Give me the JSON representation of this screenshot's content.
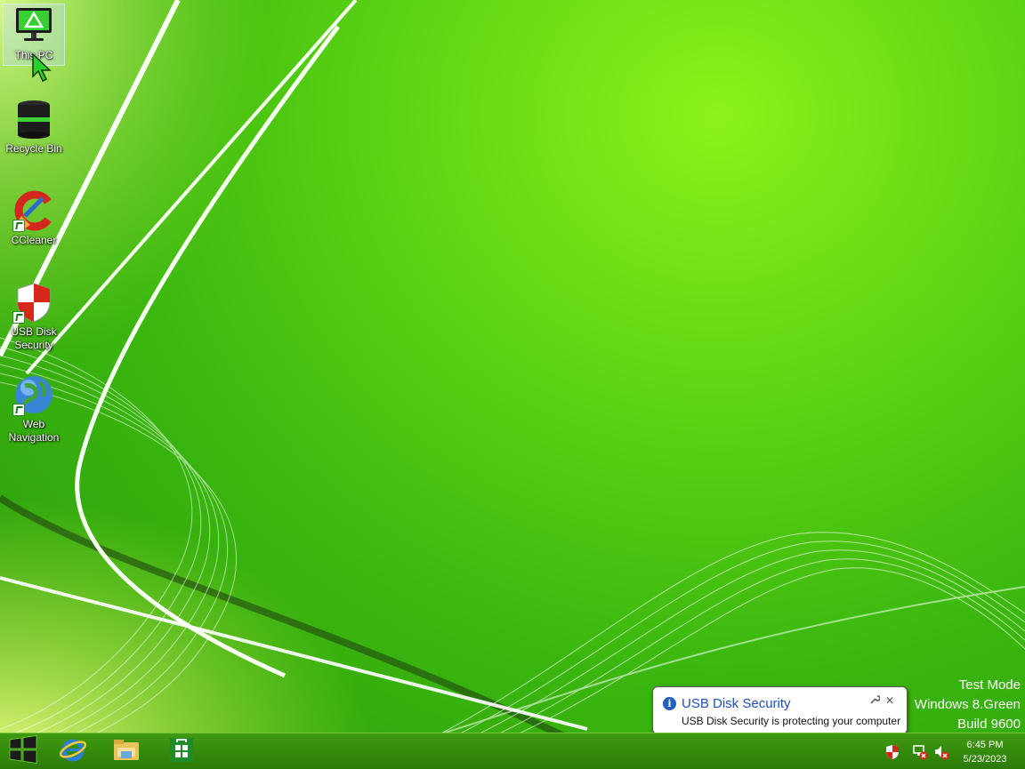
{
  "desktop": {
    "icons": [
      {
        "label": "This PC",
        "icon": "monitor-icon",
        "selected": true
      },
      {
        "label": "Recycle Bin",
        "icon": "recycle-bin-icon"
      },
      {
        "label": "CCleaner",
        "icon": "ccleaner-icon"
      },
      {
        "label": "USB Disk Security",
        "icon": "shield-icon"
      },
      {
        "label": "Web Navigation",
        "icon": "globe-icon"
      }
    ],
    "watermark": {
      "line1": "Test Mode",
      "line2": "Windows 8.Green",
      "line3": "Build 9600"
    }
  },
  "notification": {
    "title": "USB Disk Security",
    "message": "USB Disk Security is protecting your computer",
    "icon": "info-icon",
    "settings_icon": "wrench-icon",
    "close_icon": "close-icon"
  },
  "taskbar": {
    "buttons": [
      {
        "name": "start-button",
        "icon": "windows-logo-icon"
      },
      {
        "name": "internet-explorer-button",
        "icon": "internet-explorer-icon"
      },
      {
        "name": "file-explorer-button",
        "icon": "folder-icon"
      },
      {
        "name": "store-button",
        "icon": "store-icon"
      }
    ],
    "tray": {
      "icons": [
        "usb-disk-security-tray-icon",
        "network-disconnected-icon",
        "volume-muted-icon"
      ],
      "time": "6:45 PM",
      "date": "5/23/2023"
    }
  },
  "colors": {
    "accent": "#3bb70f",
    "taskbar": "#2c7a08",
    "notification_title": "#1f4fb5"
  }
}
